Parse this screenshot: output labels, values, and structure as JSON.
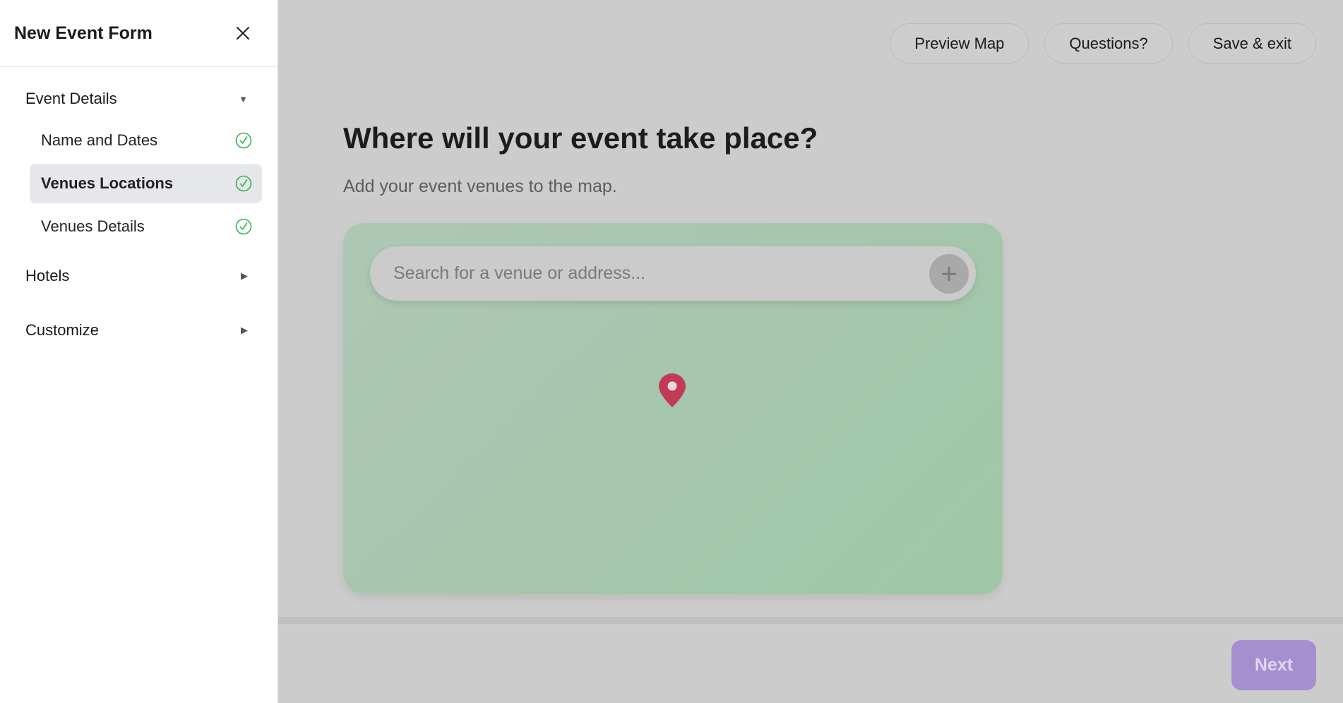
{
  "sidebar": {
    "title": "New Event Form",
    "sections": [
      {
        "label": "Event Details",
        "expanded": true,
        "items": [
          {
            "label": "Name and Dates",
            "complete": true,
            "active": false
          },
          {
            "label": "Venues Locations",
            "complete": true,
            "active": true
          },
          {
            "label": "Venues Details",
            "complete": true,
            "active": false
          }
        ]
      },
      {
        "label": "Hotels",
        "expanded": false
      },
      {
        "label": "Customize",
        "expanded": false
      }
    ]
  },
  "header": {
    "preview_map": "Preview Map",
    "questions": "Questions?",
    "save_exit": "Save & exit"
  },
  "main": {
    "heading": "Where will your event take place?",
    "subheading": "Add your event venues to the map.",
    "search": {
      "placeholder": "Search for a venue or address...",
      "value": ""
    }
  },
  "footer": {
    "next": "Next"
  },
  "colors": {
    "accent": "#a58fd1",
    "check": "#34b34a",
    "pin": "#c23a53",
    "map": "#a6c6ad"
  }
}
